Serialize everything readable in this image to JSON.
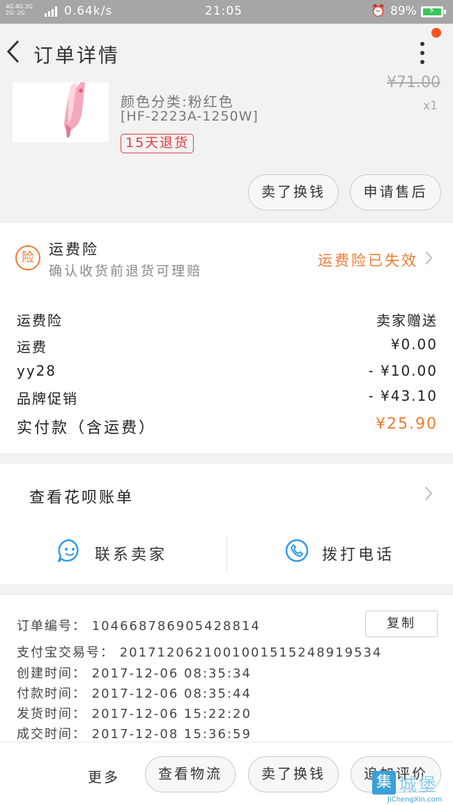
{
  "status_bar": {
    "signal_text": "4G 4G 2G\n2G: 2G",
    "net_speed": "0.64k/s",
    "time": "21:05",
    "battery": "89%",
    "icons": [
      "signal-icon",
      "alarm-icon",
      "battery-charging-icon"
    ]
  },
  "header": {
    "title": "订单详情",
    "icons": [
      "back-arrow-icon",
      "more-vertical-icon"
    ]
  },
  "product": {
    "color_attr": "颜色分类:粉红色",
    "model_attr": "[HF-2223A-1250W]",
    "return_tag": "15天退货",
    "price": "¥71.00",
    "quantity": "x1",
    "buttons": {
      "return_exchange": "卖了换钱",
      "after_sales": "申请售后"
    }
  },
  "insurance": {
    "icon_char": "险",
    "title": "运费险",
    "subtitle": "确认收货前退货可理赔",
    "status": "运费险已失效"
  },
  "costs": [
    {
      "label": "运费险",
      "value": "卖家赠送"
    },
    {
      "label": "运费",
      "value": "¥0.00"
    },
    {
      "label": "yy28",
      "value": "- ¥10.00"
    },
    {
      "label": "品牌促销",
      "value": "- ¥43.10"
    },
    {
      "label": "实付款（含运费）",
      "value": "¥25.90"
    }
  ],
  "huabei": {
    "label": "查看花呗账单"
  },
  "contact": {
    "seller": "联系卖家",
    "call": "拨打电话"
  },
  "order_info": {
    "order_no": "订单编号： 104668786905428814",
    "alipay_no": "支付宝交易号： 2017120621001001515248919534",
    "created": "创建时间： 2017-12-06 08:35:34",
    "paid": "付款时间： 2017-12-06 08:35:44",
    "shipped": "发货时间： 2017-12-06 15:22:20",
    "completed": "成交时间： 2017-12-08 15:36:59",
    "copy_label": "复制"
  },
  "footer": {
    "more": "更多",
    "logistics": "查看物流",
    "sell": "卖了换钱",
    "review": "追加评价"
  },
  "watermark": {
    "cn": "城堡",
    "box": "集",
    "en": "JiChengXin.com"
  },
  "colors": {
    "accent": "#f07a30",
    "tag_red": "#e03c3c",
    "bg": "#f2f2f2"
  }
}
